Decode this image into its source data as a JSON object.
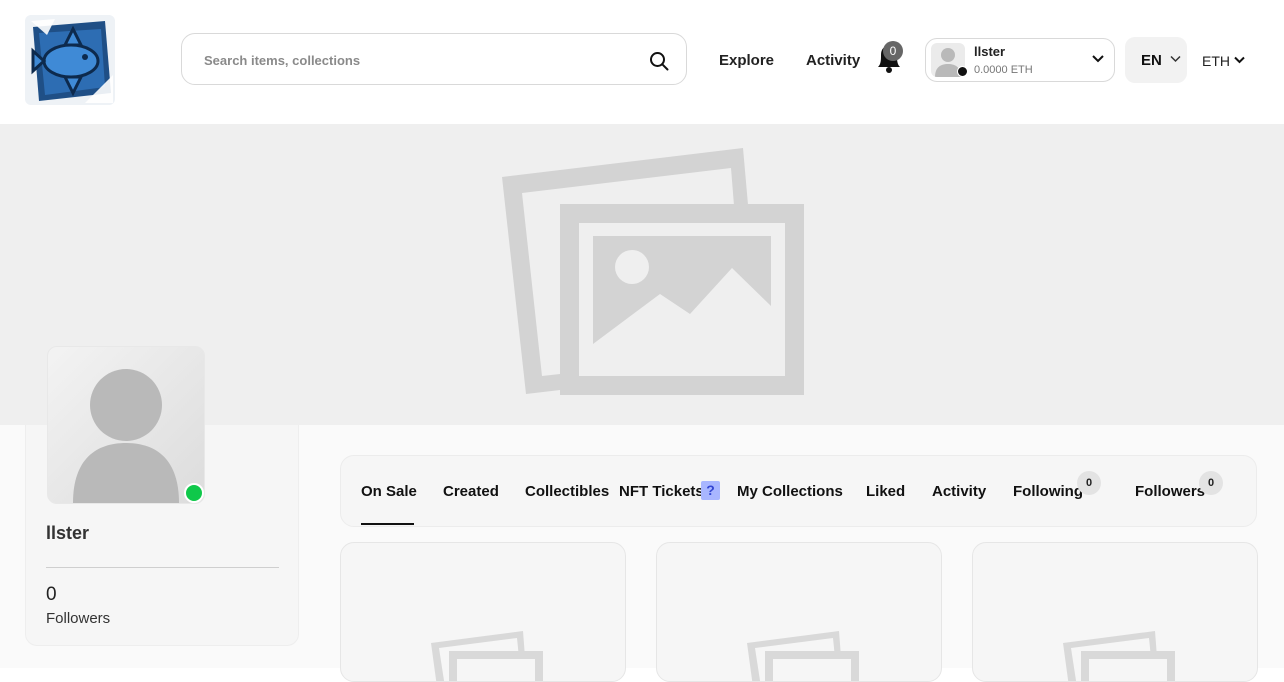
{
  "header": {
    "search": {
      "placeholder": "Search items, collections",
      "value": ""
    },
    "nav": {
      "explore": "Explore",
      "activity": "Activity"
    },
    "notifications": {
      "count": "0"
    },
    "user": {
      "name": "llster",
      "balance": "0.0000 ETH"
    },
    "language": "EN",
    "currency": "ETH"
  },
  "profile": {
    "name": "llster",
    "followers_count": "0",
    "followers_label": "Followers",
    "status_color": "#0fc84a"
  },
  "tabs": [
    {
      "label": "On Sale",
      "active": true
    },
    {
      "label": "Created"
    },
    {
      "label": "Collectibles"
    },
    {
      "label": "NFT Tickets",
      "help": "?"
    },
    {
      "label": "My Collections"
    },
    {
      "label": "Liked"
    },
    {
      "label": "Activity"
    },
    {
      "label": "Following",
      "count": "0"
    },
    {
      "label": "Followers",
      "count": "0"
    }
  ],
  "icons": [
    "logo-icon",
    "search-icon",
    "bell-icon",
    "chevron-down-icon",
    "image-placeholder-icon",
    "avatar-placeholder-icon"
  ]
}
